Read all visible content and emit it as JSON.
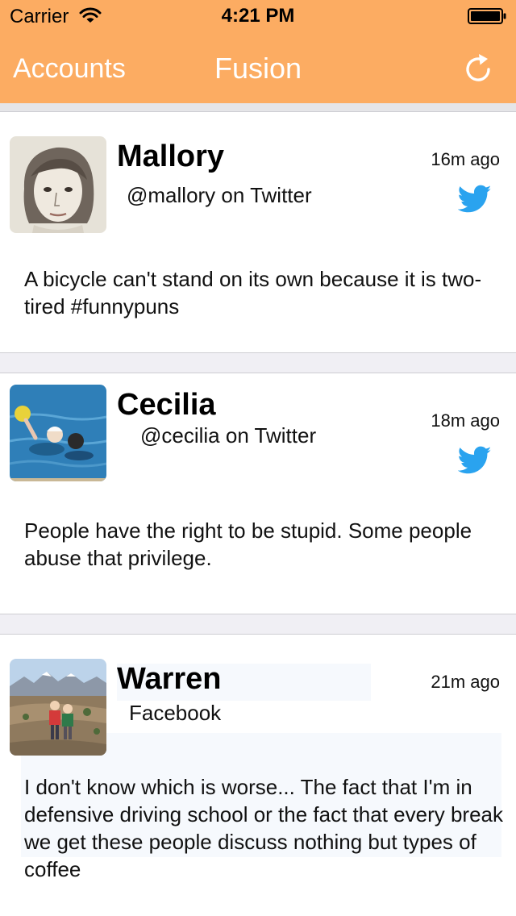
{
  "status_bar": {
    "carrier": "Carrier",
    "time": "4:21 PM",
    "wifi_icon": "wifi-icon",
    "battery_icon": "battery-icon"
  },
  "nav": {
    "left_label": "Accounts",
    "title": "Fusion",
    "right_icon": "refresh-icon"
  },
  "colors": {
    "accent": "#fcac62",
    "twitter_blue": "#2aa3ef",
    "background": "#f0eff4"
  },
  "posts": [
    {
      "name": "Mallory",
      "handle": "@mallory on Twitter",
      "time": "16m ago",
      "network_icon": "twitter-icon",
      "text": "A bicycle can't stand on its own because it is two-tired #funnypuns"
    },
    {
      "name": "Cecilia",
      "handle": "@cecilia on Twitter",
      "time": "18m ago",
      "network_icon": "twitter-icon",
      "text": "People have the right to be stupid. Some people abuse that privilege."
    },
    {
      "name": "Warren",
      "handle": "Facebook",
      "time": "21m ago",
      "network_icon": "",
      "text": "I don't know which is worse... The fact that I'm in defensive driving school or the fact that every break we get these people discuss nothing but types of coffee"
    }
  ]
}
